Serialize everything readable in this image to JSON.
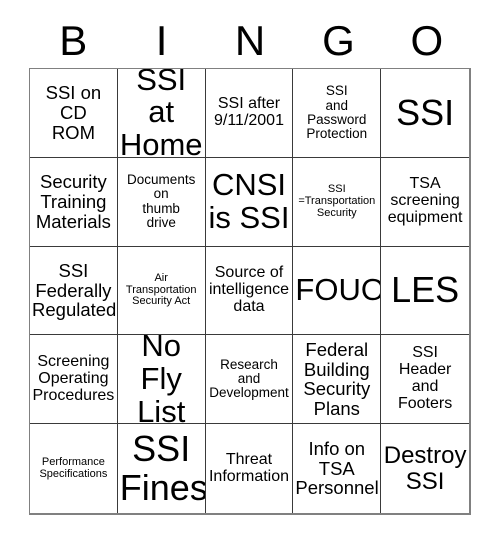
{
  "card": {
    "title": "BINGO",
    "headers": [
      "B",
      "I",
      "N",
      "G",
      "O"
    ],
    "free_space": false,
    "border_color": "#3a3a3a",
    "background_color": "#ffffff",
    "text_color": "#000000",
    "cells": [
      [
        {
          "text": "SSI on\nCD\nROM",
          "size": "fs-l"
        },
        {
          "text": "SSI at\nHome",
          "size": "fs-xxl"
        },
        {
          "text": "SSI after\n9/11/2001",
          "size": "fs-m"
        },
        {
          "text": "SSI\nand\nPassword\nProtection",
          "size": "fs-s"
        },
        {
          "text": "SSI",
          "size": "fs-huge"
        }
      ],
      [
        {
          "text": "Security\nTraining\nMaterials",
          "size": "fs-l"
        },
        {
          "text": "Documents\non\nthumb\ndrive",
          "size": "fs-s"
        },
        {
          "text": "CNSI\nis SSI",
          "size": "fs-xxl"
        },
        {
          "text": "SSI\n=Transportation\nSecurity",
          "size": "fs-xs"
        },
        {
          "text": "TSA\nscreening\nequipment",
          "size": "fs-m"
        }
      ],
      [
        {
          "text": "SSI\nFederally\nRegulated",
          "size": "fs-l"
        },
        {
          "text": "Air\nTransportation\nSecurity Act",
          "size": "fs-xs"
        },
        {
          "text": "Source of\nintelligence\ndata",
          "size": "fs-m"
        },
        {
          "text": "FOUO",
          "size": "fs-xxl"
        },
        {
          "text": "LES",
          "size": "fs-huge"
        }
      ],
      [
        {
          "text": "Screening\nOperating\nProcedures",
          "size": "fs-m"
        },
        {
          "text": "No Fly\nList",
          "size": "fs-xxl"
        },
        {
          "text": "Research\nand\nDevelopment",
          "size": "fs-s"
        },
        {
          "text": "Federal\nBuilding\nSecurity\nPlans",
          "size": "fs-l"
        },
        {
          "text": "SSI\nHeader\nand\nFooters",
          "size": "fs-m"
        }
      ],
      [
        {
          "text": "Performance\nSpecifications",
          "size": "fs-xs"
        },
        {
          "text": "SSI\nFines",
          "size": "fs-huge"
        },
        {
          "text": "Threat\nInformation",
          "size": "fs-m"
        },
        {
          "text": "Info on\nTSA\nPersonnel",
          "size": "fs-l"
        },
        {
          "text": "Destroy\nSSI",
          "size": "fs-xl"
        }
      ]
    ]
  }
}
